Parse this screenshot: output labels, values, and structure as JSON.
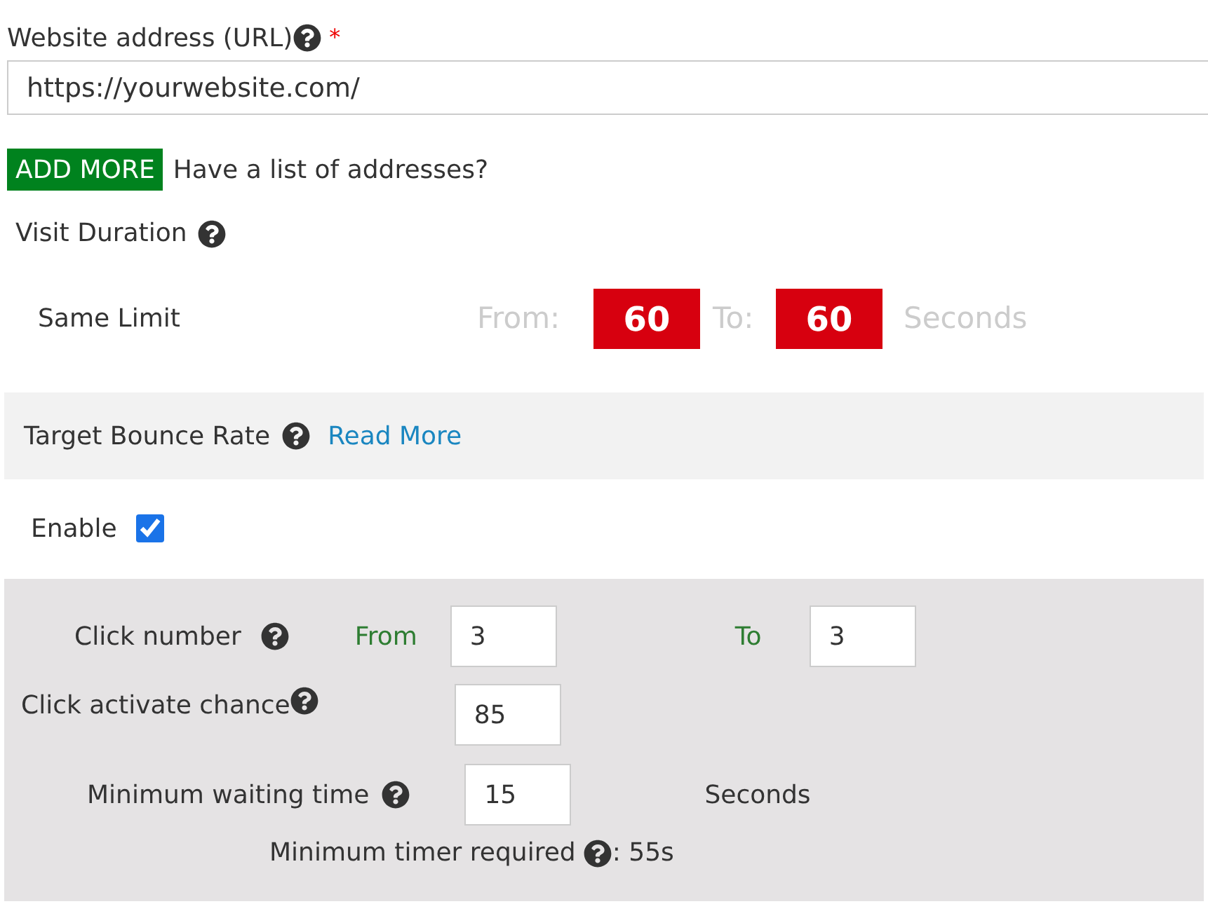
{
  "url_field": {
    "label": "Website address (URL)",
    "required_mark": "*",
    "value": "https://yourwebsite.com/"
  },
  "add_more": {
    "button": "ADD MORE",
    "text": "Have a list of addresses?"
  },
  "visit_duration": {
    "title": "Visit Duration",
    "mode": "Same Limit",
    "from_label": "From:",
    "from_value": "60",
    "to_label": "To:",
    "to_value": "60",
    "unit": "Seconds"
  },
  "bounce": {
    "title": "Target Bounce Rate",
    "link": "Read More",
    "enable_label": "Enable",
    "enabled": true
  },
  "click_number": {
    "label": "Click number",
    "from_label": "From",
    "from_value": "3",
    "to_label": "To",
    "to_value": "3"
  },
  "click_chance": {
    "label": "Click activate chance",
    "value": "85"
  },
  "min_wait": {
    "label": "Minimum waiting time",
    "value": "15",
    "unit": "Seconds"
  },
  "min_timer": {
    "label": "Minimum timer required",
    "value": ": 55s"
  }
}
